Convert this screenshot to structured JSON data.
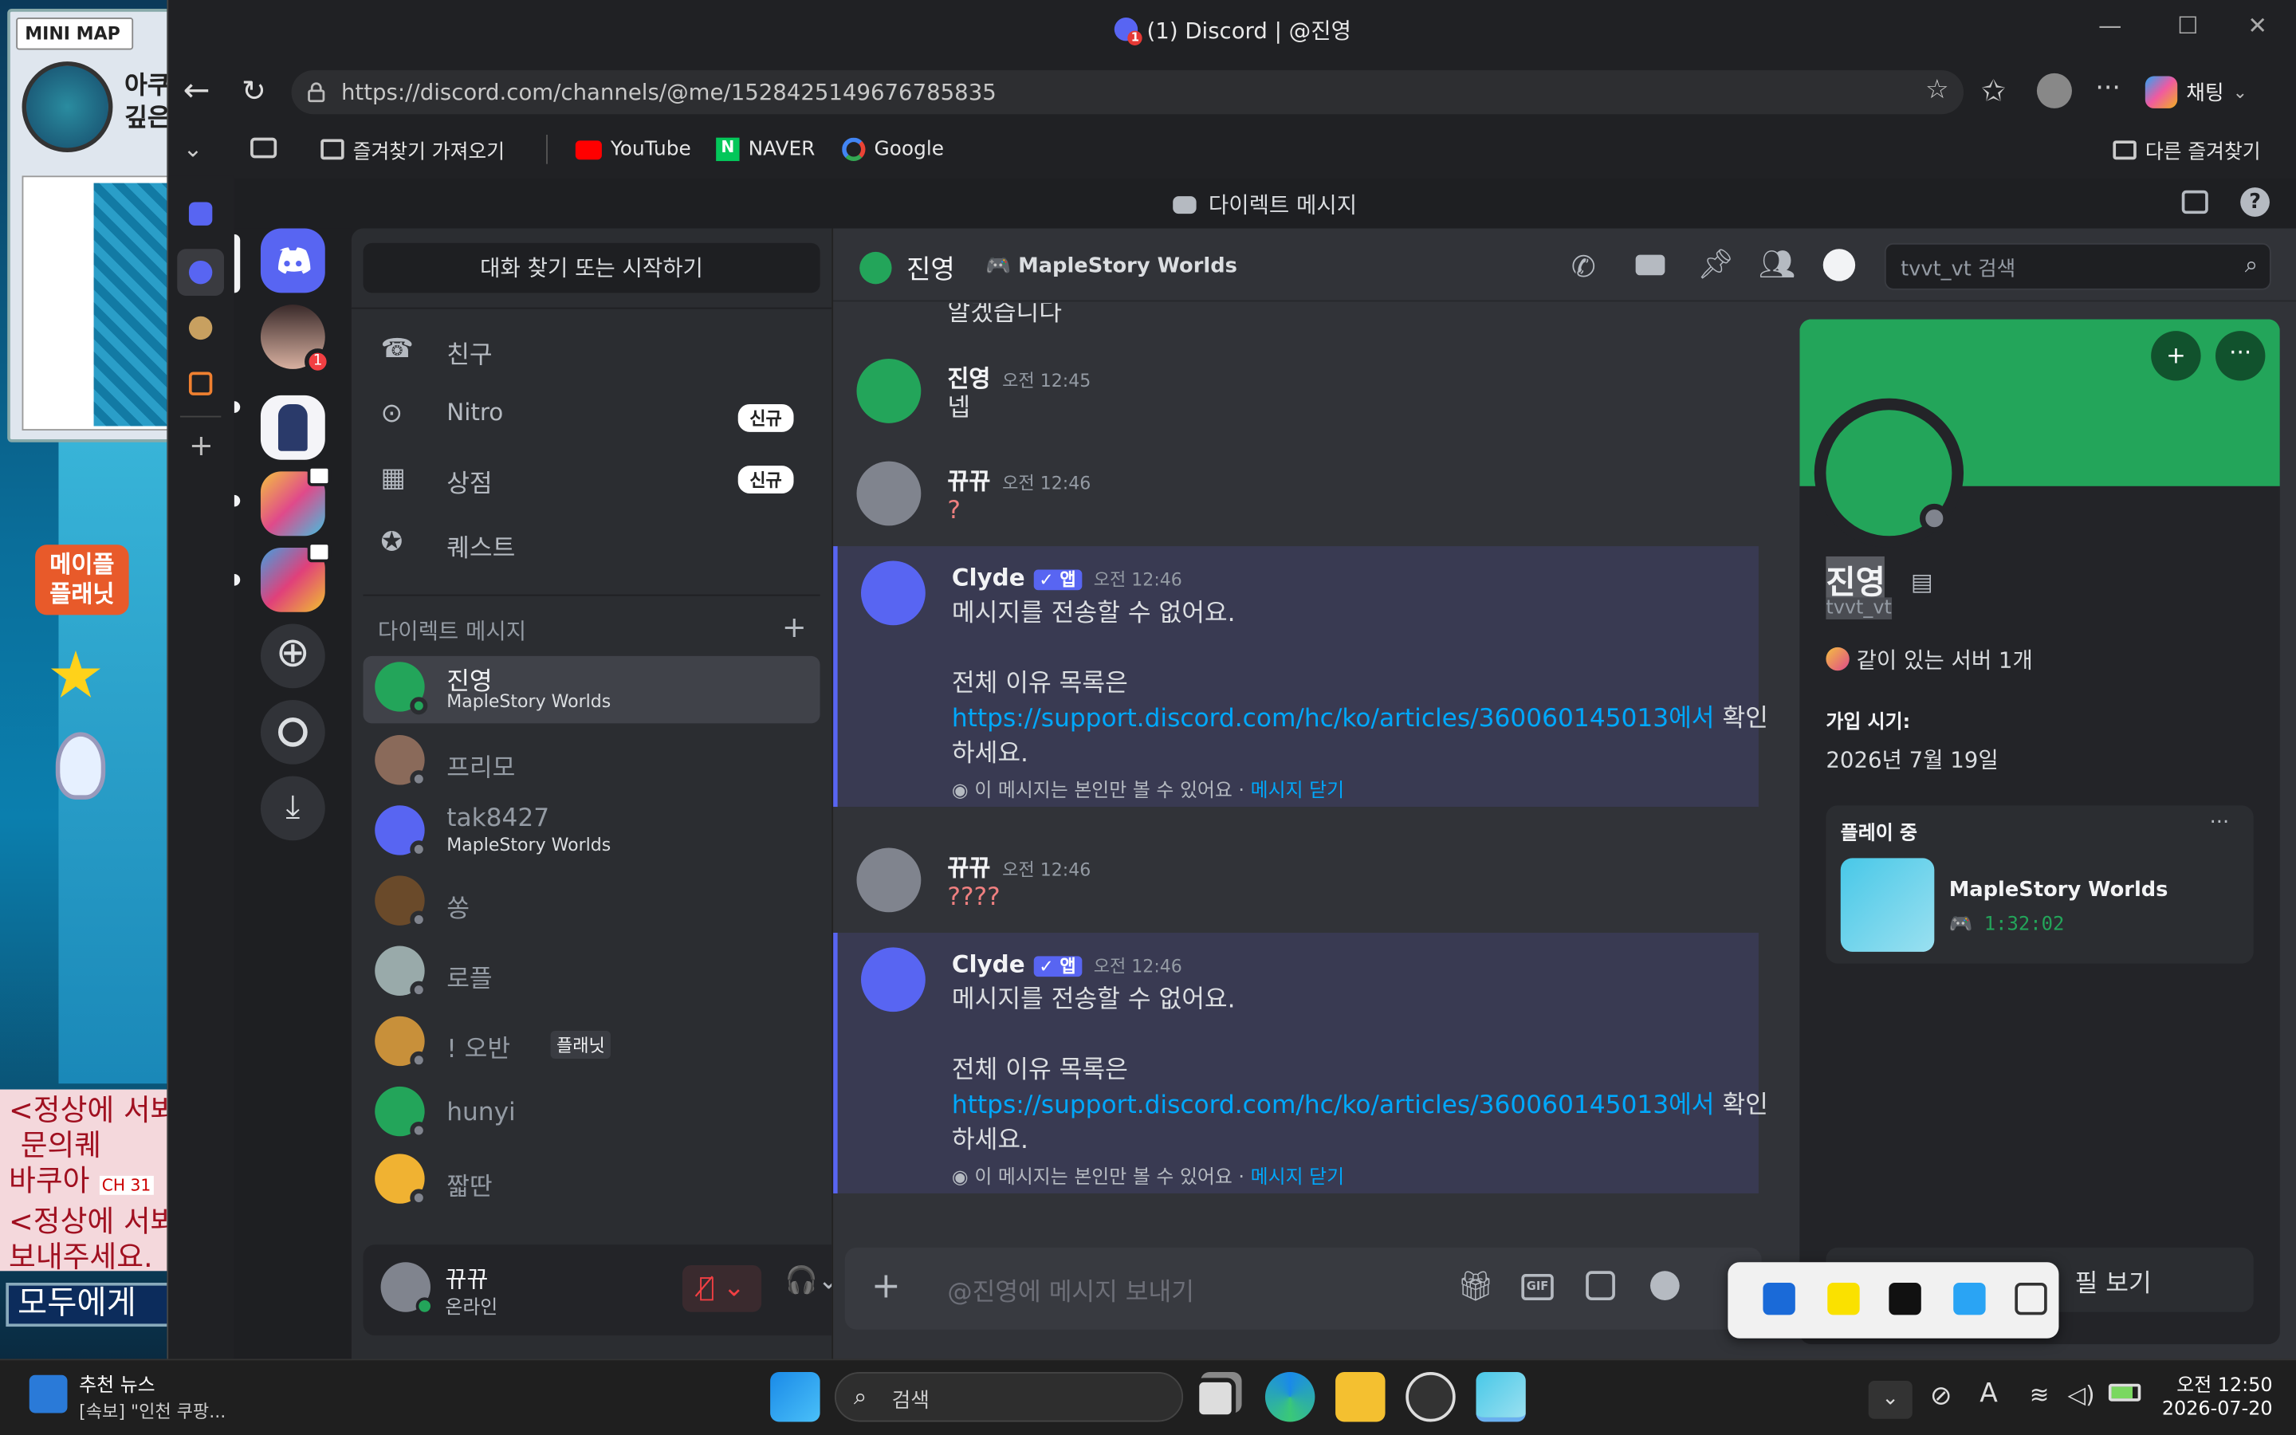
{
  "game": {
    "minimap_label": "MINI MAP",
    "map_title": "아쿠\n깊은",
    "notice_lines": [
      "<정상에 서봐",
      "문의퀘",
      "바쿠아",
      "<정상에 서봐",
      "보내주세요."
    ],
    "channel": "CH 31",
    "all_button": "모두에게",
    "maple_logo": "메이플\n플래닛"
  },
  "browser": {
    "tab_title": "(1) Discord | @진영",
    "url": "https://discord.com/channels/@me/1528425149676785835",
    "chat_button": "채팅",
    "bookmarks": [
      {
        "label": "즐겨찾기 가져오기"
      },
      {
        "label": "YouTube"
      },
      {
        "label": "NAVER"
      },
      {
        "label": "Google"
      }
    ],
    "other_bookmarks": "다른 즐겨찾기",
    "tab_badge": "1"
  },
  "discord": {
    "window_title": "다이렉트 메시지",
    "servers": [
      {
        "name": "home"
      },
      {
        "name": "friend-avatar",
        "badge": "1"
      },
      {
        "name": "anime-server"
      },
      {
        "name": "maple-server-1"
      },
      {
        "name": "maple-server-2"
      }
    ],
    "search_placeholder": "대화 찾기 또는 시작하기",
    "nav": [
      {
        "label": "친구",
        "badge": ""
      },
      {
        "label": "Nitro",
        "badge": "신규"
      },
      {
        "label": "상점",
        "badge": "신규"
      },
      {
        "label": "퀘스트",
        "badge": ""
      }
    ],
    "dm_header": "다이렉트 메시지",
    "dms": [
      {
        "name": "진영",
        "sub": "MapleStory Worlds",
        "color": "#23a55a",
        "active": true
      },
      {
        "name": "프리모",
        "sub": "",
        "color": "#8a6a5a"
      },
      {
        "name": "tak8427",
        "sub": "MapleStory Worlds",
        "color": "#5865f2"
      },
      {
        "name": "쏭",
        "sub": "",
        "color": "#6a4a2a"
      },
      {
        "name": "로플",
        "sub": "",
        "color": "#9aa"
      },
      {
        "name": "! 오반",
        "sub": "",
        "tag": "플래닛",
        "color": "#c8903a"
      },
      {
        "name": "hunyi",
        "sub": "",
        "color": "#23a55a"
      },
      {
        "name": "짧딴",
        "sub": "",
        "color": "#f0b232"
      }
    ],
    "user": {
      "name": "뀨뀨",
      "status": "온라인"
    },
    "chat": {
      "channel_name": "진영",
      "activity": "MapleStory Worlds",
      "header_search": "tvvt_vt 검색",
      "truncated": "알겠습니다",
      "input_placeholder": "@진영에 메시지 보내기"
    },
    "messages": [
      {
        "author": "진영",
        "time": "오전 12:45",
        "text": "넵",
        "type": "user",
        "color": "#23a55a"
      },
      {
        "author": "뀨뀨",
        "time": "오전 12:46",
        "text": "?",
        "type": "user",
        "color": "#80848e"
      },
      {
        "author": "Clyde",
        "badge": "✓ 앱",
        "time": "오전 12:46",
        "line1": "메시지를 전송할 수 없어요.",
        "line2": "전체 이유 목록은",
        "link": "https://support.discord.com/hc/ko/articles/360060145013에서",
        "after_link": " 확인",
        "line3": "하세요.",
        "note": "이 메시지는 본인만 볼 수 있어요 · ",
        "dismiss": "메시지 닫기",
        "type": "bot"
      },
      {
        "author": "뀨뀨",
        "time": "오전 12:46",
        "text": "????",
        "type": "user",
        "color": "#80848e"
      },
      {
        "author": "Clyde",
        "badge": "✓ 앱",
        "time": "오전 12:46",
        "line1": "메시지를 전송할 수 없어요.",
        "line2": "전체 이유 목록은",
        "link": "https://support.discord.com/hc/ko/articles/360060145013에서",
        "after_link": " 확인",
        "line3": "하세요.",
        "note": "이 메시지는 본인만 볼 수 있어요 · ",
        "dismiss": "메시지 닫기",
        "type": "bot"
      }
    ],
    "profile": {
      "display_name": "진영",
      "username": "tvvt_vt",
      "mutual_servers": "같이 있는 서버 1개",
      "joined_label": "가입 시기:",
      "joined_date": "2026년 7월 19일",
      "playing_label": "플레이 중",
      "game_name": "MapleStory Worlds",
      "game_time": "1:32:02",
      "full_profile": "필 보기",
      "banner_color": "#23a55a"
    }
  },
  "taskbar": {
    "news_title": "추천 뉴스",
    "news_sub": "[속보] \"인천 쿠팡...",
    "search": "검색",
    "clock_time": "오전 12:50",
    "clock_date": "2026-07-20",
    "ime": "A"
  }
}
